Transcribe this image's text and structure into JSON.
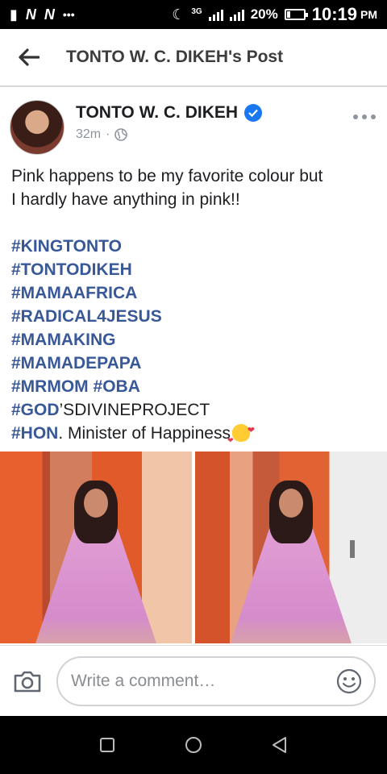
{
  "status_bar": {
    "carrier_icons": [
      "N",
      "N"
    ],
    "dots": "•••",
    "network_label": "3G",
    "battery": "20%",
    "battery_level": 0.2,
    "time": "10:19",
    "ampm": "PM"
  },
  "header": {
    "title": "TONTO W. C. DIKEH's Post"
  },
  "post": {
    "author": "TONTO W. C. DIKEH",
    "time": "32m",
    "separator": "·",
    "text_line1": "Pink happens to be my favorite colour but",
    "text_line2": "I hardly have anything in pink!!",
    "hashtags": {
      "h1": "#KINGTONTO",
      "h2": "#TONTODIKEH",
      "h3": "#MAMAAFRICA",
      "h4": "#RADICAL4JESUS",
      "h5": "#MAMAKING",
      "h6": "#MAMADEPAPA",
      "h7a": "#MRMOM",
      "h7b": "#OBA",
      "h8a": "#GOD",
      "h8b": "’SDIVINEPROJECT",
      "h9a": "#HON",
      "h9b": ". Minister of Happiness"
    }
  },
  "comment": {
    "placeholder": "Write a comment…"
  },
  "colors": {
    "hashtag": "#385898",
    "verified": "#1877f2",
    "dress": "#e4a0d6"
  }
}
